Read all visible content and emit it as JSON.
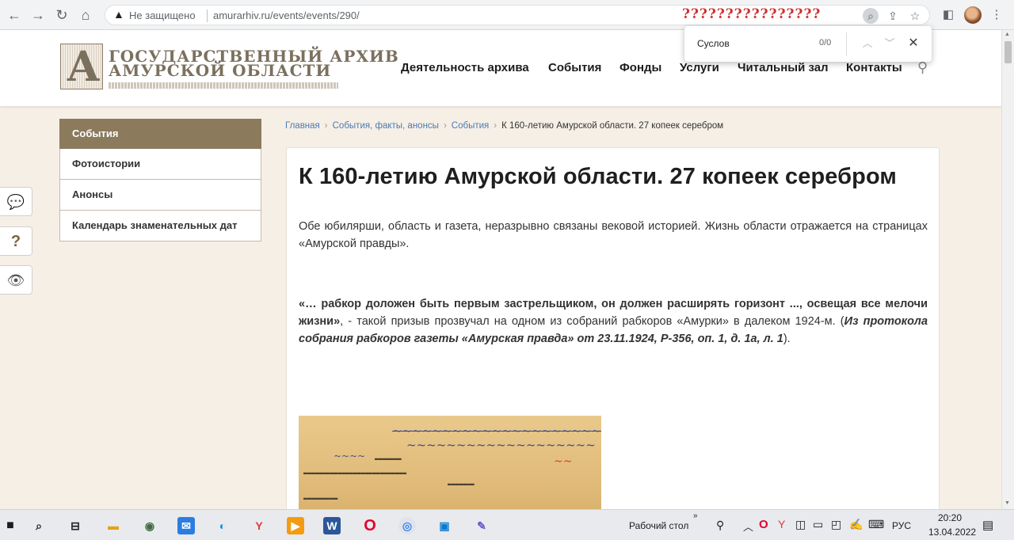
{
  "browser": {
    "security_label": "Не защищено",
    "url": "amurarhiv.ru/events/events/290/",
    "find_text": "Суслов",
    "find_count": "0/0",
    "overlay_text": "????????????????"
  },
  "site": {
    "logo_line1": "ГОСУДАРСТВЕННЫЙ АРХИВ",
    "logo_line2": "АМУРСКОЙ ОБЛАСТИ",
    "nav": [
      "Деятельность архива",
      "События",
      "Фонды",
      "Услуги",
      "Читальный зал",
      "Контакты"
    ]
  },
  "sidebar": {
    "items": [
      "События",
      "Фотоистории",
      "Анонсы",
      "Календарь знаменательных дат"
    ]
  },
  "breadcrumbs": [
    "Главная",
    "События, факты, анонсы",
    "События",
    "К 160-летию Амурской области. 27 копеек серебром"
  ],
  "article": {
    "title": "К 160-летию Амурской области. 27 копеек серебром",
    "intro": "Обе юбилярши, область и газета, неразрывно связаны вековой историей. Жизнь области отражается на страницах «Амурской правды».",
    "quote_bold": "«… рабкор доложен быть первым застрельщиком, он должен расширять горизонт ..., освещая все мелочи жизни»",
    "quote_text": ", - такой призыв прозвучал на одном из собраний рабкоров «Амурки» в далеком 1924-м. (",
    "quote_source": "Из протокола собрания рабкоров газеты «Амурская правда» от 23.11.1924, Р-356, оп. 1, д. 1а, л. 1",
    "quote_end": ")."
  },
  "taskbar": {
    "desktop_label": "Рабочий стол",
    "lang": "РУС",
    "time": "20:20",
    "date": "13.04.2022"
  }
}
